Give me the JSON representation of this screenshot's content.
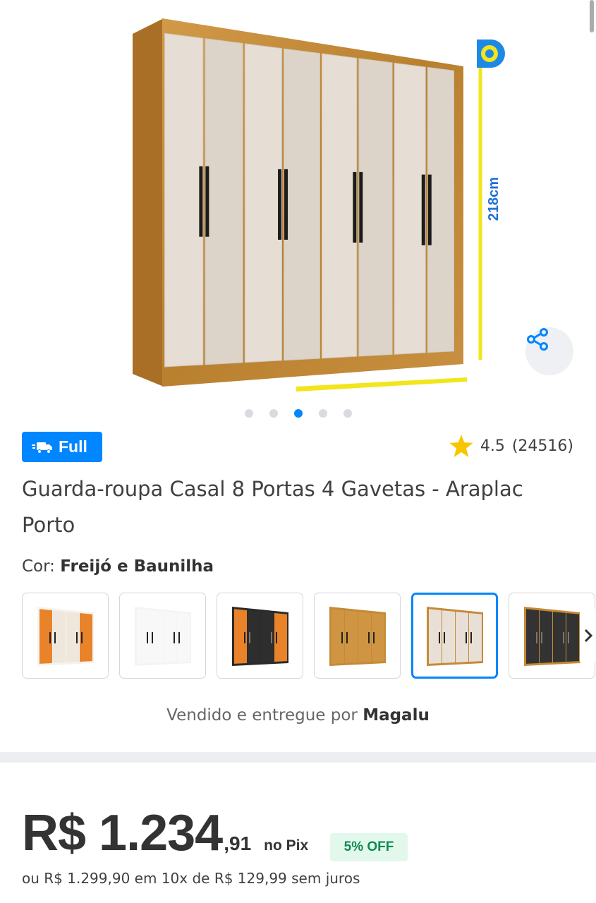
{
  "product": {
    "image": {
      "measure_label": "218cm",
      "carousel": {
        "count": 5,
        "active_index": 2
      }
    },
    "share_icon": "share-icon",
    "badge": {
      "label": "Full",
      "icon": "fast-truck-icon"
    },
    "rating": {
      "value": "4.5",
      "count": "(24516)",
      "icon": "star-icon"
    },
    "title": "Guarda-roupa Casal 8 Portas 4 Gavetas - Araplac Porto",
    "color": {
      "label": "Cor:",
      "value": "Freijó e Baunilha"
    },
    "variants": [
      {
        "frame": "#f6f3ee",
        "doors": [
          "#e8832a",
          "#efe7dc",
          "#efe7dc",
          "#e8832a"
        ]
      },
      {
        "frame": "#f4f4f4",
        "doors": [
          "#f8f8f8",
          "#f8f8f8",
          "#f8f8f8",
          "#f8f8f8"
        ]
      },
      {
        "frame": "#2a2a2a",
        "doors": [
          "#e8832a",
          "#2e2e2e",
          "#2e2e2e",
          "#e8832a"
        ]
      },
      {
        "frame": "#c58a36",
        "doors": [
          "#cf9542",
          "#cf9542",
          "#cf9542",
          "#cf9542"
        ]
      },
      {
        "frame": "#c58a36",
        "doors": [
          "#e8e0d6",
          "#e8e0d6",
          "#e8e0d6",
          "#e8e0d6"
        ],
        "selected": true
      },
      {
        "frame": "#c58a36",
        "doors": [
          "#333333",
          "#333333",
          "#333333",
          "#333333"
        ]
      }
    ],
    "next_icon": "chevron-right-icon",
    "seller": {
      "prefix": "Vendido e entregue por",
      "name": "Magalu"
    }
  },
  "price": {
    "main": "R$ 1.234",
    "cents": ",91",
    "method": "no Pix",
    "discount": "5% OFF",
    "installments": "ou R$ 1.299,90 em 10x de R$ 129,99 sem juros"
  },
  "colors": {
    "accent": "#0086ff",
    "wood": "#c58a36",
    "door": "#e8e0d6",
    "measure": "#f2e51c",
    "discount_bg": "#e3f8ec",
    "discount_text": "#0e8a52"
  }
}
